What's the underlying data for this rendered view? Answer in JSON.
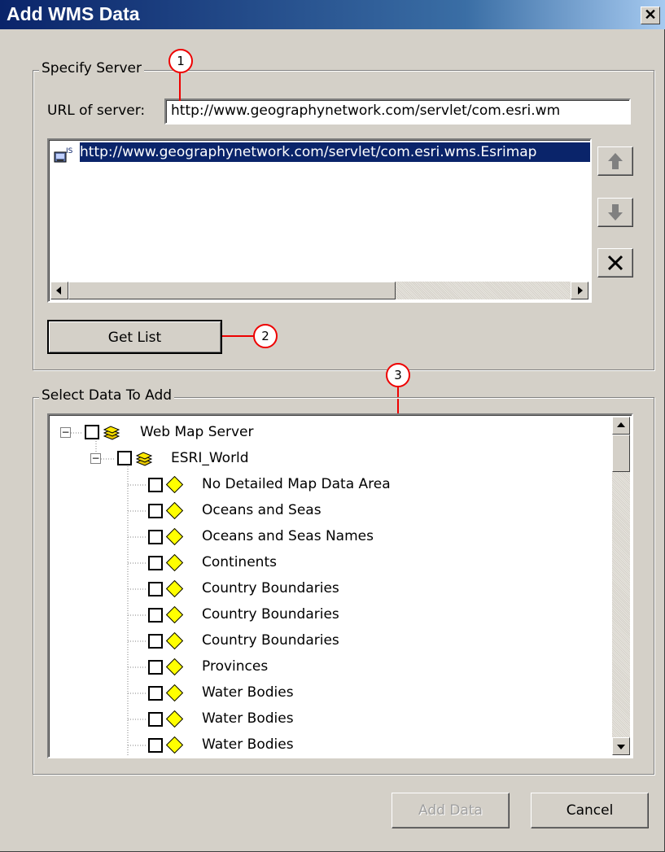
{
  "window": {
    "title": "Add WMS Data",
    "close_glyph": "✕"
  },
  "specify_server": {
    "legend": "Specify Server",
    "url_label": "URL of server:",
    "url_value": "http://www.geographynetwork.com/servlet/com.esri.wm",
    "server_list": [
      {
        "url": "http://www.geographynetwork.com/servlet/com.esri.wms.Esrimap",
        "icon": "wms-server-icon",
        "selected": true
      }
    ],
    "get_list_label": "Get List"
  },
  "callouts": {
    "one": "1",
    "two": "2",
    "three": "3"
  },
  "select_data": {
    "legend": "Select Data To Add",
    "tree": [
      {
        "label": "Web Map Server",
        "level": 0,
        "type": "group"
      },
      {
        "label": "ESRI_World",
        "level": 1,
        "type": "group"
      },
      {
        "label": "No Detailed Map Data Area",
        "level": 2,
        "type": "layer"
      },
      {
        "label": "Oceans and Seas",
        "level": 2,
        "type": "layer"
      },
      {
        "label": "Oceans and Seas Names",
        "level": 2,
        "type": "layer"
      },
      {
        "label": "Continents",
        "level": 2,
        "type": "layer"
      },
      {
        "label": "Country Boundaries",
        "level": 2,
        "type": "layer"
      },
      {
        "label": "Country Boundaries",
        "level": 2,
        "type": "layer"
      },
      {
        "label": "Country Boundaries",
        "level": 2,
        "type": "layer"
      },
      {
        "label": "Provinces",
        "level": 2,
        "type": "layer"
      },
      {
        "label": "Water Bodies",
        "level": 2,
        "type": "layer"
      },
      {
        "label": "Water Bodies",
        "level": 2,
        "type": "layer"
      },
      {
        "label": "Water Bodies",
        "level": 2,
        "type": "layer"
      }
    ]
  },
  "buttons": {
    "add_data": "Add Data",
    "cancel": "Cancel"
  },
  "colors": {
    "title_bar": "#0a246a",
    "selection": "#0a246a",
    "callout_ring": "#ee0000",
    "layer_diamond": "#ffff00",
    "group_layers": "#e8c800"
  }
}
